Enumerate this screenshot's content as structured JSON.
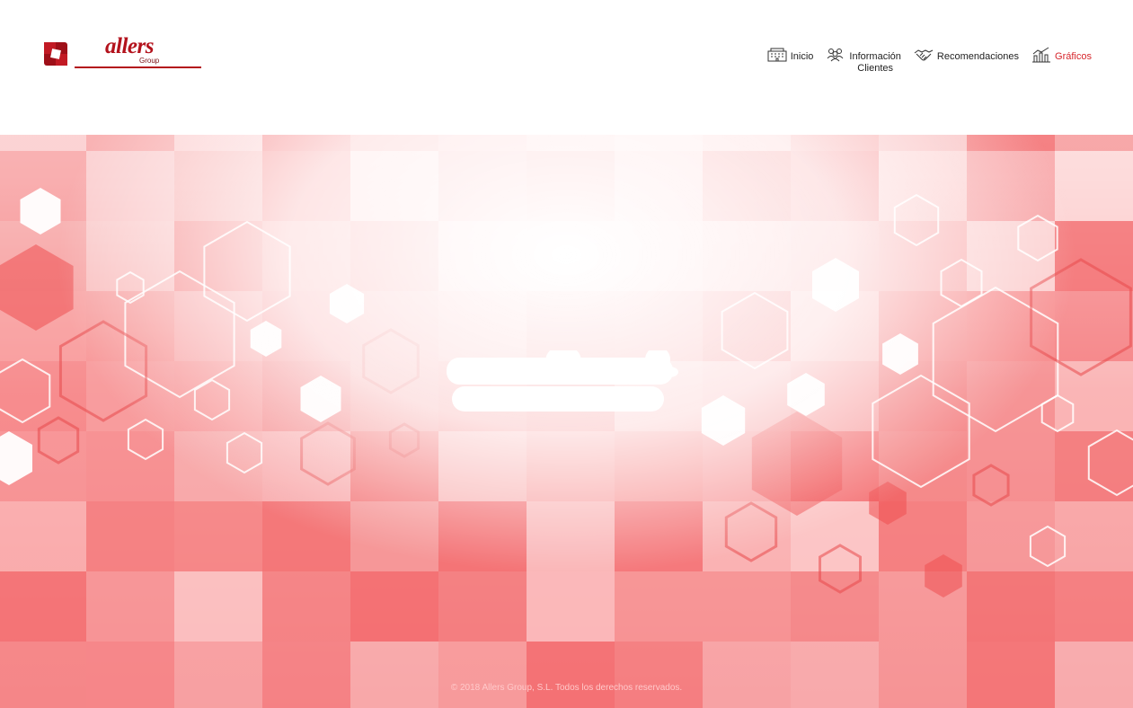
{
  "brand": {
    "name": "allers",
    "sub": "Group"
  },
  "nav": {
    "items": [
      {
        "label": "Inicio",
        "icon": "building-icon",
        "active": false
      },
      {
        "label": "Información\nClientes",
        "icon": "users-icon",
        "active": false
      },
      {
        "label": "Recomendaciones",
        "icon": "handshake-icon",
        "active": false
      },
      {
        "label": "Gráficos",
        "icon": "chart-icon",
        "active": true
      }
    ]
  },
  "colors": {
    "accent": "#d6252b",
    "brand": "#b3121c",
    "hero_base": "#f05a5c"
  },
  "footer": {
    "text": "© 2018 Allers Group, S.L. Todos los derechos reservados."
  }
}
